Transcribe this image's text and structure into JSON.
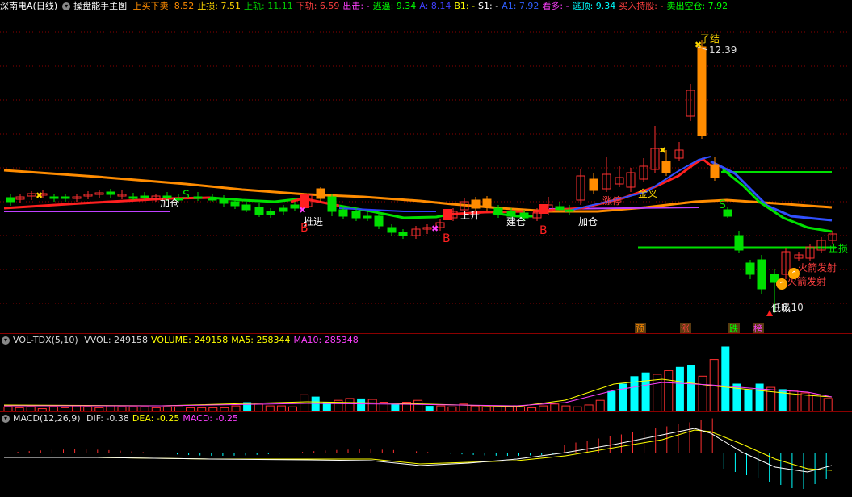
{
  "main": {
    "stock_name": "深南电A(日线)",
    "indicator_name": "操盘能手主图",
    "indicators": [
      {
        "label": "上买下卖:",
        "value": "8.52",
        "color": "#ff8c00"
      },
      {
        "label": "止损:",
        "value": "7.51",
        "color": "#ffd700"
      },
      {
        "label": "上轨:",
        "value": "11.11",
        "color": "#00cc00"
      },
      {
        "label": "下轨:",
        "value": "6.59",
        "color": "#ff4040"
      },
      {
        "label": "出击:",
        "value": "-",
        "color": "#ff40ff"
      },
      {
        "label": "逃逼:",
        "value": "9.34",
        "color": "#00ff00"
      },
      {
        "label": "A:",
        "value": "8.14",
        "color": "#4040ff"
      },
      {
        "label": "B1:",
        "value": "-",
        "color": "#ffff00"
      },
      {
        "label": "S1:",
        "value": "-",
        "color": "#ffffff"
      },
      {
        "label": "A1:",
        "value": "7.92",
        "color": "#3060ff"
      },
      {
        "label": "看多:",
        "value": "-",
        "color": "#ff40ff"
      },
      {
        "label": "逃顶:",
        "value": "9.34",
        "color": "#00ffff"
      },
      {
        "label": "买入持股:",
        "value": "-",
        "color": "#ff4040"
      },
      {
        "label": "卖出空仓:",
        "value": "7.92",
        "color": "#00ff00"
      }
    ],
    "price_high": "12.39",
    "price_low": "6.10",
    "annotations": {
      "jiacang1": "加仓",
      "tuijin": "推进",
      "jiancang": "建仓",
      "jiacang2": "加仓",
      "shangsheng": "上升",
      "zhangting": "涨停",
      "jincha": "金叉",
      "liaojie": "了结",
      "zhisun": "止损",
      "huojian1": "火箭发射",
      "huojian2": "火箭发射",
      "dixi": "低吸",
      "b1": "B",
      "b2": "B",
      "b3": "B",
      "s1": "S",
      "s2": "S"
    },
    "tags": [
      {
        "label": "预",
        "color": "#ff8c00"
      },
      {
        "label": "涨",
        "color": "#ff4040"
      },
      {
        "label": "跌",
        "color": "#00ff00"
      },
      {
        "label": "榜",
        "color": "#ff40ff"
      }
    ]
  },
  "volume": {
    "name": "VOL-TDX(5,10)",
    "items": [
      {
        "label": "VVOL:",
        "value": "249158",
        "color": "#dddddd"
      },
      {
        "label": "VOLUME:",
        "value": "249158",
        "color": "#ffff00"
      },
      {
        "label": "MA5:",
        "value": "258344",
        "color": "#ffff00"
      },
      {
        "label": "MA10:",
        "value": "285348",
        "color": "#ff40ff"
      }
    ]
  },
  "macd": {
    "name": "MACD(12,26,9)",
    "items": [
      {
        "label": "DIF:",
        "value": "-0.38",
        "color": "#dddddd"
      },
      {
        "label": "DEA:",
        "value": "-0.25",
        "color": "#ffff00"
      },
      {
        "label": "MACD:",
        "value": "-0.25",
        "color": "#ff40ff"
      }
    ]
  },
  "colors": {
    "up": "#ff3030",
    "down": "#00e000",
    "grid": "#8b0000",
    "bg": "#000000",
    "cyan": "#00ffff"
  }
}
